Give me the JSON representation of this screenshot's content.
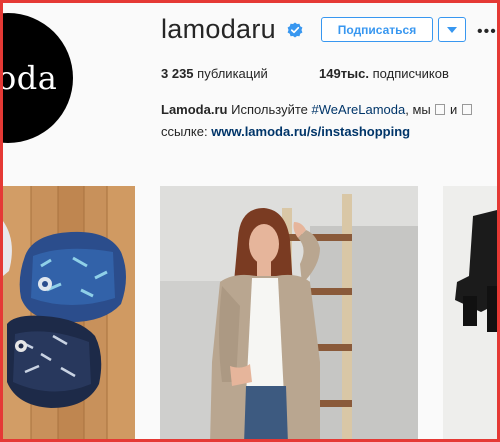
{
  "profile": {
    "avatar_text": "oda",
    "username": "lamodaru",
    "follow_label": "Подписаться",
    "stats": {
      "posts_count": "3 235",
      "posts_label": "публикаций",
      "followers_count": "149тыс.",
      "followers_label": "подписчиков"
    },
    "bio": {
      "name": "Lamoda.ru",
      "text_before": "Используйте",
      "hashtag": "#WeAreLamoda",
      "text_after": ", мы",
      "text_and": "и",
      "line2_prefix": "ссылке:",
      "link": "www.lamoda.ru/s/instashopping"
    }
  },
  "colors": {
    "accent": "#3897f0",
    "frame_border": "#e53935",
    "link": "#003569"
  },
  "icons": [
    "verified-badge-icon",
    "chevron-down-icon",
    "more-options-icon"
  ]
}
